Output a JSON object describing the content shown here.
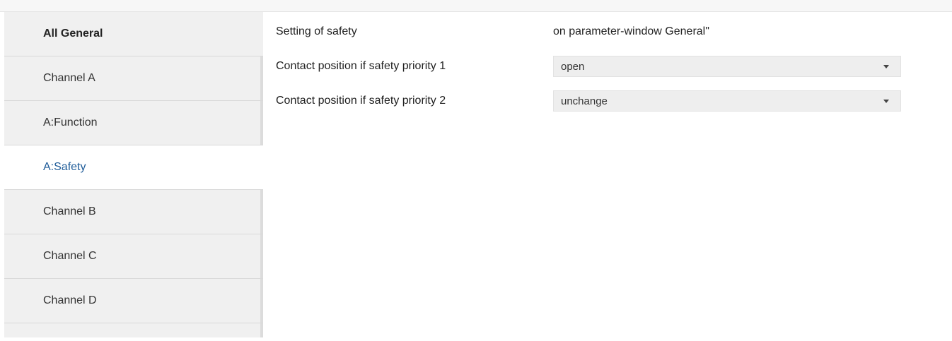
{
  "sidebar": {
    "items": [
      {
        "label": "All General"
      },
      {
        "label": "Channel A"
      },
      {
        "label": "A:Function"
      },
      {
        "label": "A:Safety"
      },
      {
        "label": "Channel B"
      },
      {
        "label": "Channel C"
      },
      {
        "label": "Channel D"
      }
    ],
    "active_index": 3
  },
  "main": {
    "setting": {
      "label": "Setting of safety",
      "value": "on parameter-window General\""
    },
    "params": [
      {
        "label": "Contact position if safety priority 1",
        "value": "open"
      },
      {
        "label": "Contact position if safety priority 2",
        "value": "unchange"
      }
    ]
  },
  "colors": {
    "active_item": "#1f5c99",
    "item_background": "#f0f0f0",
    "select_background": "#eeeeee"
  }
}
